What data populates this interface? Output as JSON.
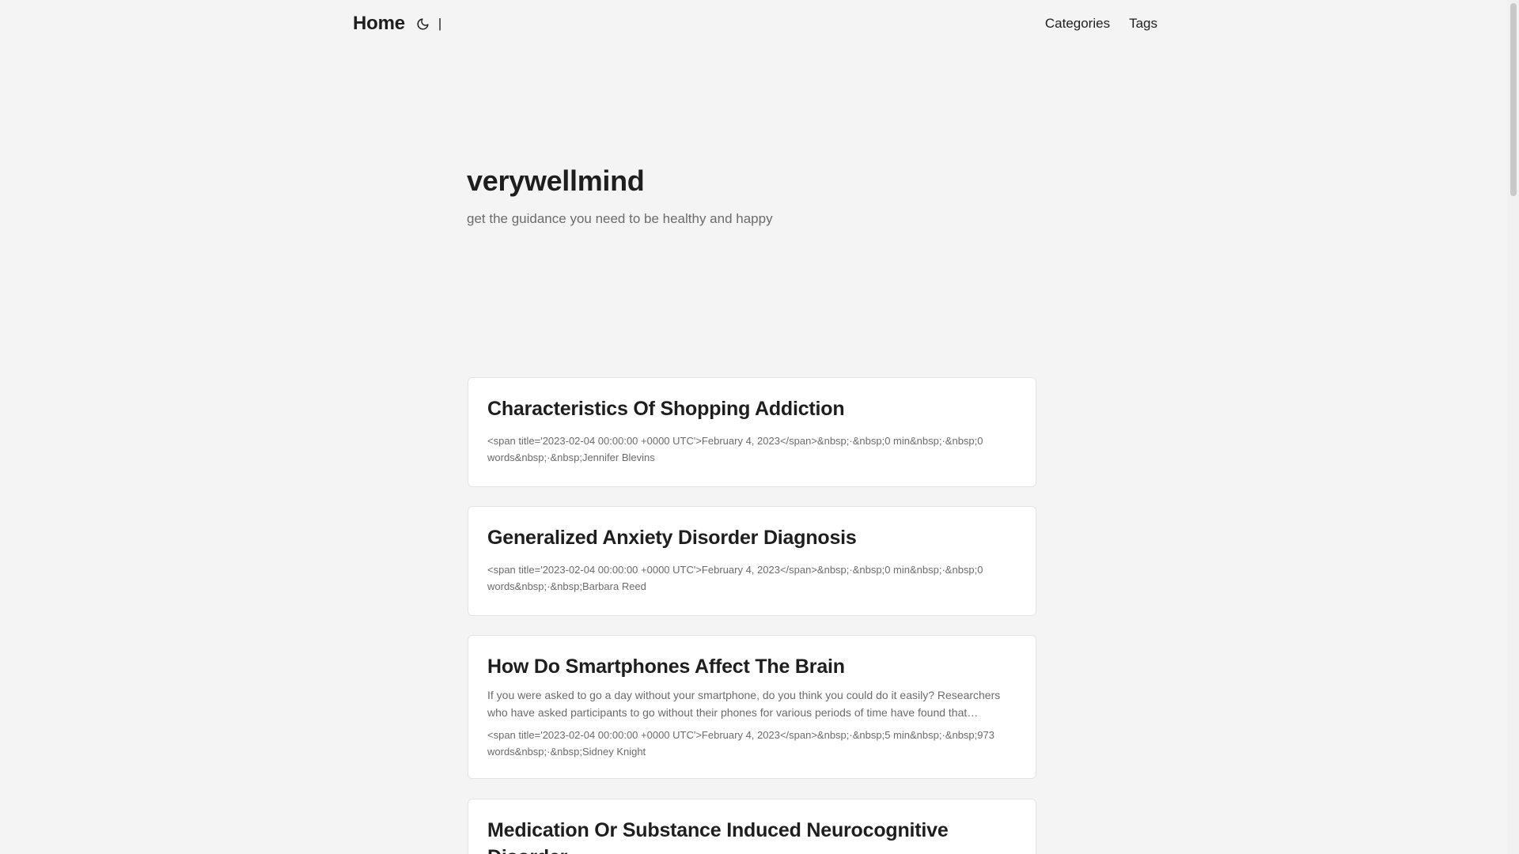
{
  "header": {
    "home_label": "Home",
    "separator": "|",
    "nav": [
      {
        "label": "Categories"
      },
      {
        "label": "Tags"
      }
    ]
  },
  "intro": {
    "title": "verywellmind",
    "subtitle": "get the guidance you need to be healthy and happy"
  },
  "posts": [
    {
      "title": "Characteristics Of Shopping Addiction",
      "summary": "",
      "meta": "<span title='2023-02-04 00:00:00 +0000 UTC'>February 4, 2023</span>&nbsp;·&nbsp;0 min&nbsp;·&nbsp;0 words&nbsp;·&nbsp;Jennifer Blevins"
    },
    {
      "title": "Generalized Anxiety Disorder Diagnosis",
      "summary": "",
      "meta": "<span title='2023-02-04 00:00:00 +0000 UTC'>February 4, 2023</span>&nbsp;·&nbsp;0 min&nbsp;·&nbsp;0 words&nbsp;·&nbsp;Barbara Reed"
    },
    {
      "title": "How Do Smartphones Affect The Brain",
      "summary": "If you were asked to go a day without your smartphone, do you think you could do it easily? Researchers who have asked participants to go without their phones for various periods of time have found that breakin…",
      "meta": "<span title='2023-02-04 00:00:00 +0000 UTC'>February 4, 2023</span>&nbsp;·&nbsp;5 min&nbsp;·&nbsp;973 words&nbsp;·&nbsp;Sidney Knight"
    },
    {
      "title": "Medication Or Substance Induced Neurocognitive Disorder",
      "summary": "",
      "meta": ""
    }
  ],
  "icons": {
    "theme_toggle": "moon-icon"
  }
}
